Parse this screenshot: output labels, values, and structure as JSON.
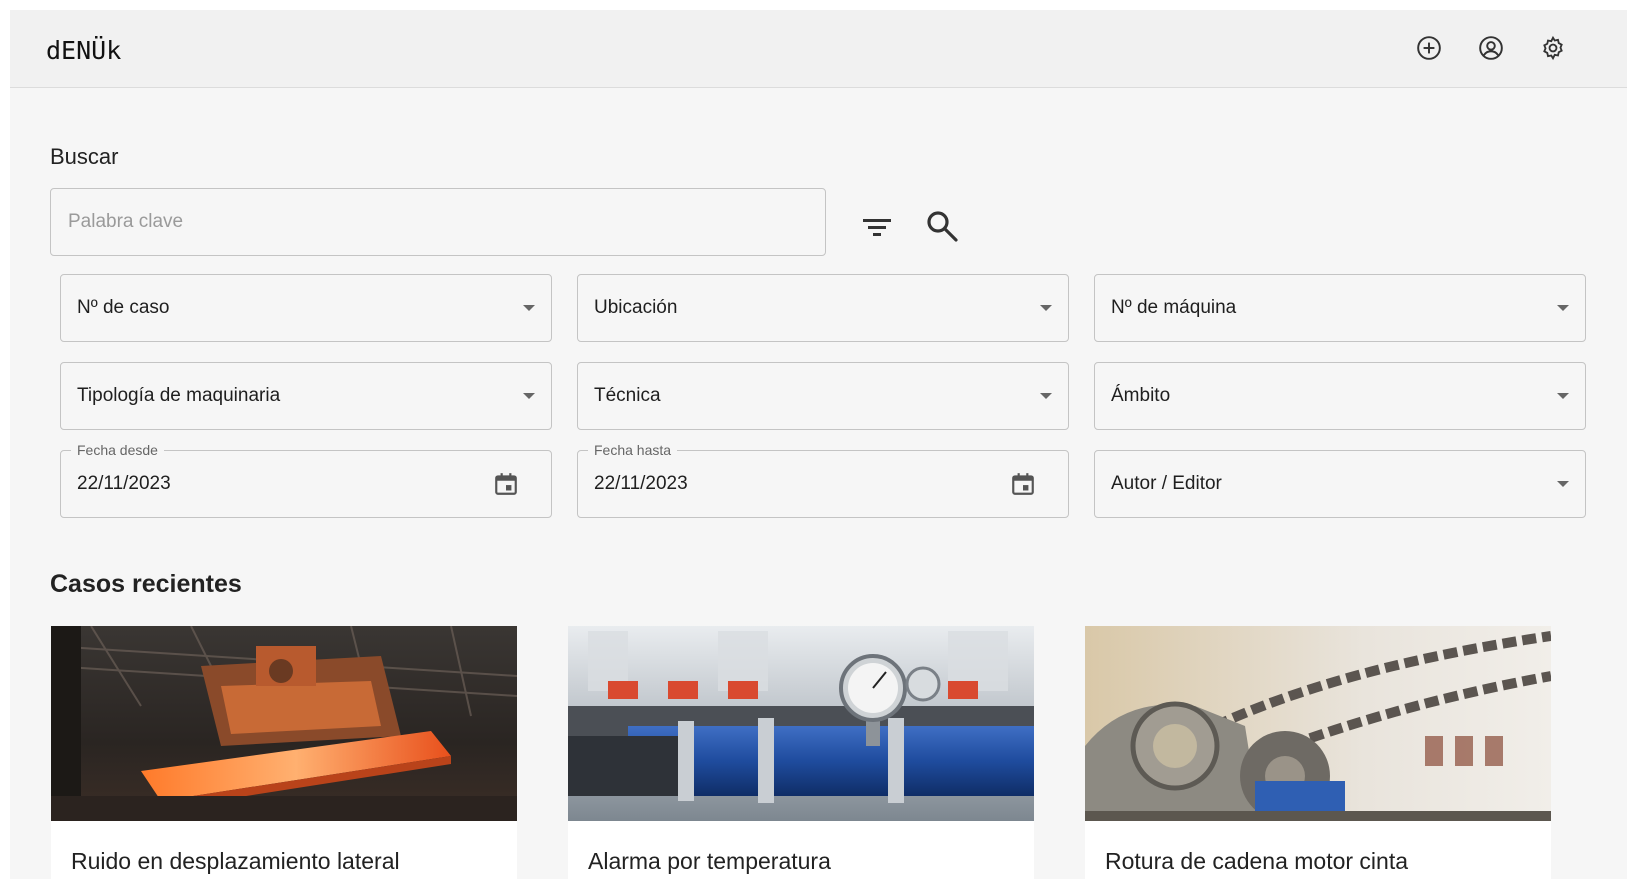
{
  "header": {
    "logo": "dENÜk",
    "icons": [
      "add-circle-icon",
      "account-circle-icon",
      "settings-icon"
    ]
  },
  "search": {
    "label": "Buscar",
    "placeholder": "Palabra clave",
    "value": ""
  },
  "filters": {
    "case_number": "Nº de caso",
    "location": "Ubicación",
    "machine_number": "Nº de máquina",
    "machine_type": "Tipología de maquinaria",
    "technique": "Técnica",
    "scope": "Ámbito",
    "date_from_label": "Fecha desde",
    "date_from": "22/11/2023",
    "date_to_label": "Fecha hasta",
    "date_to": "22/11/2023",
    "author": "Autor / Editor"
  },
  "recent": {
    "title": "Casos recientes",
    "cards": [
      {
        "title": "Ruido en desplazamiento lateral"
      },
      {
        "title": "Alarma por temperatura"
      },
      {
        "title": "Rotura de cadena motor cinta"
      }
    ]
  },
  "colors": {
    "background": "#f6f6f6",
    "topbar": "#f1f1f1",
    "border": "#c4c4c4",
    "text": "#1f1f1f"
  }
}
